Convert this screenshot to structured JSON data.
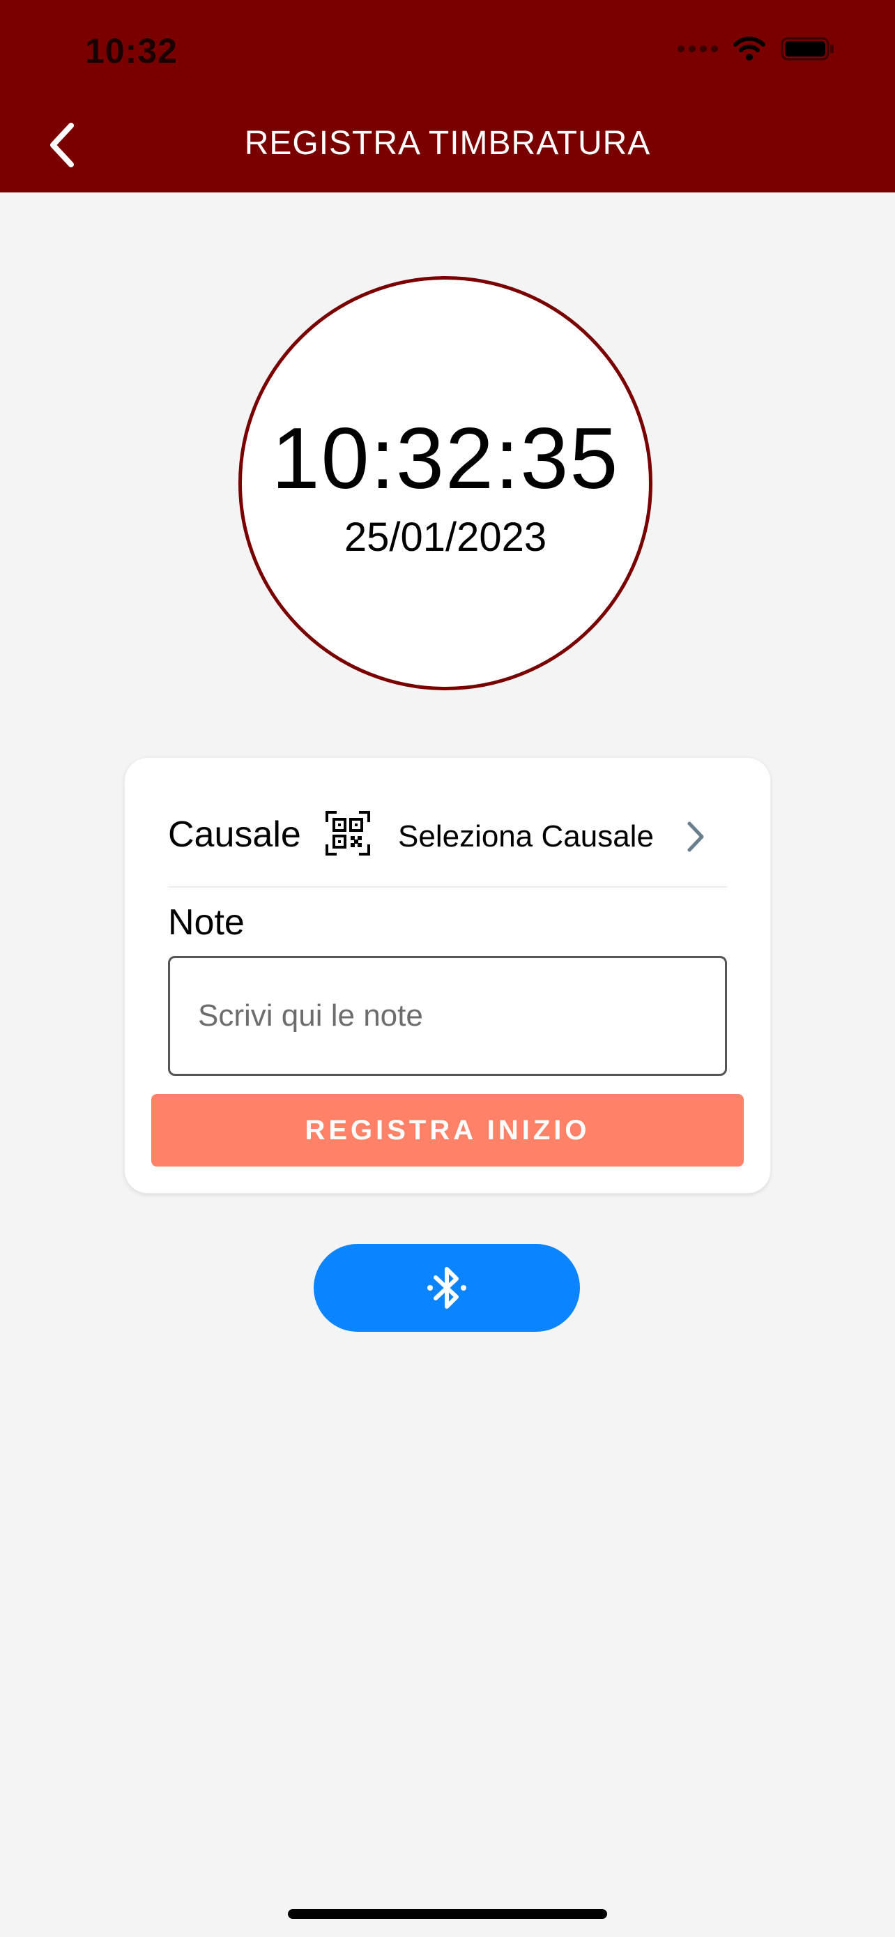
{
  "status_bar": {
    "time": "10:32"
  },
  "header": {
    "title": "REGISTRA TIMBRATURA",
    "back_icon": "chevron-left-icon"
  },
  "clock": {
    "time": "10:32:35",
    "date": "25/01/2023"
  },
  "form": {
    "causale_label": "Causale",
    "causale_value": "Seleziona Causale",
    "causale_icon": "qr-code-icon",
    "note_label": "Note",
    "note_placeholder": "Scrivi qui le note",
    "note_value": "",
    "submit_label": "REGISTRA INIZIO"
  },
  "bluetooth_button": {
    "icon": "bluetooth-icon"
  },
  "colors": {
    "header": "#7a0000",
    "accent_button": "#ff8268",
    "bluetooth_button": "#0a84ff",
    "background": "#f4f4f4"
  }
}
